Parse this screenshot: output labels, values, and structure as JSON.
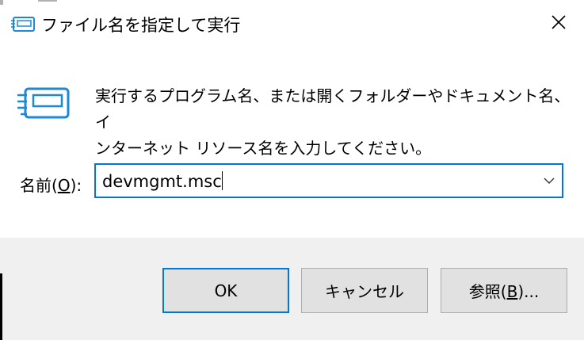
{
  "window": {
    "title": "ファイル名を指定して実行"
  },
  "icons": {
    "title": "run-icon",
    "main": "run-icon",
    "close": "close-icon",
    "dropdown": "chevron-down-icon"
  },
  "description": {
    "line1": "実行するプログラム名、または開くフォルダーやドキュメント名、イ",
    "line2": "ンターネット リソース名を入力してください。"
  },
  "name_field": {
    "label_prefix": "名前(",
    "label_accel": "O",
    "label_suffix": "):",
    "value": "devmgmt.msc"
  },
  "buttons": {
    "ok": "OK",
    "cancel": "キャンセル",
    "browse_prefix": "参照(",
    "browse_accel": "B",
    "browse_suffix": ")..."
  },
  "colors": {
    "accent": "#0078d7",
    "footer_bg": "#f0f0f0",
    "button_bg": "#e1e1e1",
    "icon_blue": "#1e88d6"
  }
}
